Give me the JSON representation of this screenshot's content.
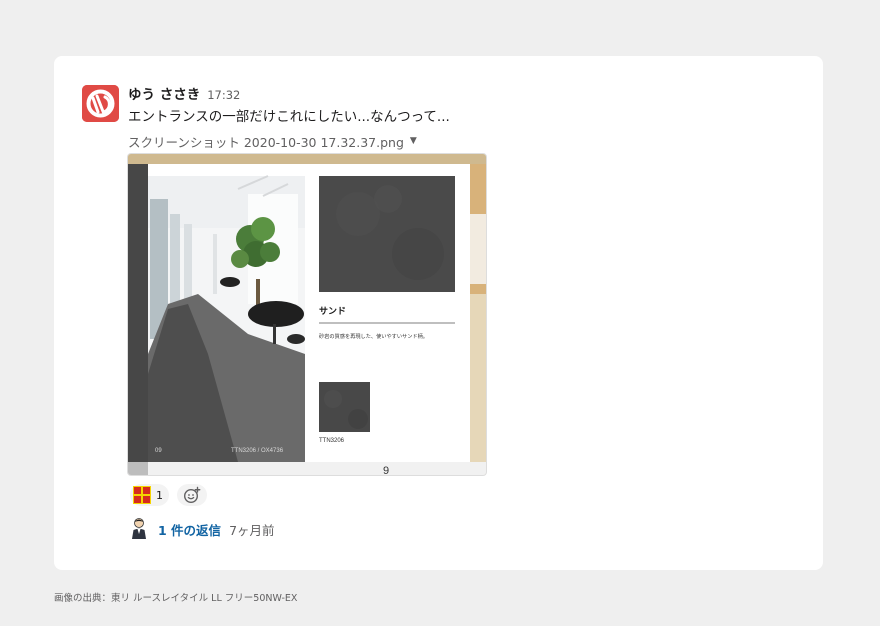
{
  "message": {
    "author": "ゆう ささき",
    "time": "17:32",
    "text": "エントランスの一部だけこれにしたい...なんつって...",
    "attachment": {
      "filename": "スクリーンショット 2020-10-30 17.32.37.png",
      "dropdown_icon": "caret-down-icon",
      "image": {
        "product_name": "サンド",
        "product_description": "砂岩の質感を再現した、使いやすいサンド柄。",
        "sample_code": "TTN3206",
        "page_left": "09",
        "page_code": "TTN3206 / OX4736",
        "page_number": "9"
      }
    },
    "reactions": [
      {
        "emoji": "sotsugyo-emoji",
        "count": "1"
      }
    ],
    "add_reaction_icon": "add-emoji-icon",
    "thread": {
      "reply_label": "1 件の返信",
      "reply_time": "7ヶ月前"
    }
  },
  "footer": {
    "credit": "画像の出典：東リ ルースレイタイル LL フリー50NW-EX"
  },
  "colors": {
    "background": "#efefef",
    "card": "#ffffff",
    "avatar": "#e04a45",
    "link": "#1264a3",
    "muted": "#616061"
  }
}
